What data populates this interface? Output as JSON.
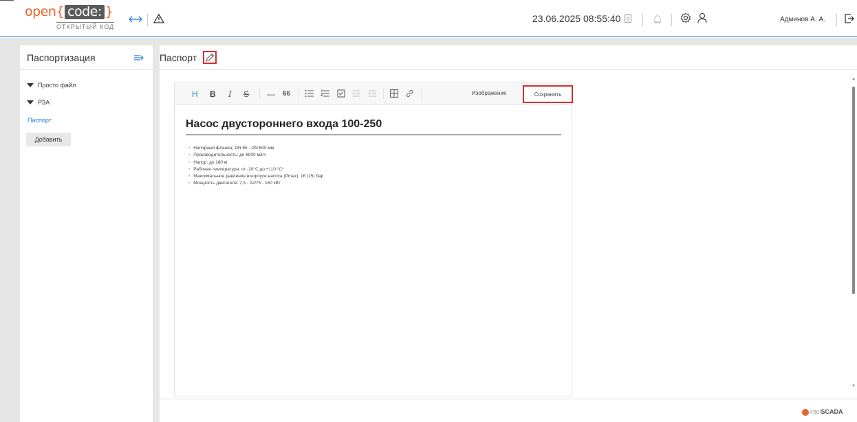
{
  "header": {
    "logo_prefix": "open{",
    "logo_code": "code:",
    "logo_suffix": "}",
    "logo_subtitle": "ОТКРЫТЫЙ КОД",
    "datetime": "23.06.2025 08:55:40",
    "user_name": "Админов А. А.",
    "icons": [
      "arrows-left-right-icon",
      "warning-icon",
      "document-icon",
      "alarm-icon",
      "settings-icon",
      "user-icon",
      "logout-icon"
    ]
  },
  "left_panel": {
    "title": "Паспортизация",
    "tree": [
      {
        "label": "Просто файл"
      },
      {
        "label": "РЗА"
      }
    ],
    "selected_link": "Паспорт",
    "add_button": "Добавить"
  },
  "main": {
    "title": "Паспорт",
    "toolbar": {
      "image_label": "Изображение",
      "save_label": "Сохранить"
    },
    "document": {
      "heading": "Насос двустороннего входа 100-250",
      "items": [
        "Напорный фланец: DN 65 - DN 600 мм",
        "Производительность: до 6000 м3/ч",
        "Напор: до 180 м",
        "Рабочая температура: от -20°C до +110 °C*",
        "Максимальное давление в корпусе насоса (Pmax): 16 (25) бар",
        "Мощность двигателя: 7,5 - 22/75 - 160 кВт"
      ]
    }
  },
  "footer": {
    "brand_intel": "intel",
    "brand_scada": "SCADA"
  },
  "colors": {
    "accent": "#2a7bd1",
    "highlight": "#d32f2f",
    "logo_orange": "#e8632b"
  }
}
